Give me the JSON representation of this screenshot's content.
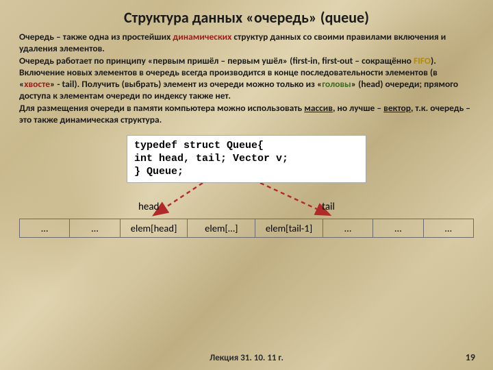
{
  "title": "Структура данных «очередь» (queue)",
  "p": {
    "s1a": "Очередь – также одна из простейших ",
    "s1b": "динамических",
    "s1c": " структур данных со своими правилами включения и удаления элементов.",
    "s2a": "Очередь работает по принципу «первым пришёл – первым ушёл» (first-in, first-out – сокращённо ",
    "s2b": "FIFO",
    "s2c": "). Включение новых элементов в очередь всегда производится в конце последовательности элементов (в «",
    "s2d": "хвосте",
    "s2e": "» - tail). Получить (выбрать) элемент из очереди можно только из «",
    "s2f": "головы",
    "s2g": "» (head) очереди; прямого доступа к элементам очереди по индексу также нет.",
    "s3a": "Для размещения очереди в памяти компьютера можно использовать ",
    "s3b": "массив",
    "s3c": ", но лучше – ",
    "s3d": "вектор",
    "s3e": ", т.к. очередь – это также динамическая структура."
  },
  "code": {
    "l1": "typedef struct Queue{",
    "l2": "  int head, tail; Vector v;",
    "l3": "} Queue;"
  },
  "labels": {
    "head": "head",
    "tail": "tail"
  },
  "cells": [
    "…",
    "…",
    "elem[head]",
    "elem[…]",
    "elem[tail-1]",
    "…",
    "…",
    "…"
  ],
  "footer": "Лекция  31. 10. 11 г.",
  "page": "19",
  "colors": {
    "arrow": "#b02a2a"
  }
}
